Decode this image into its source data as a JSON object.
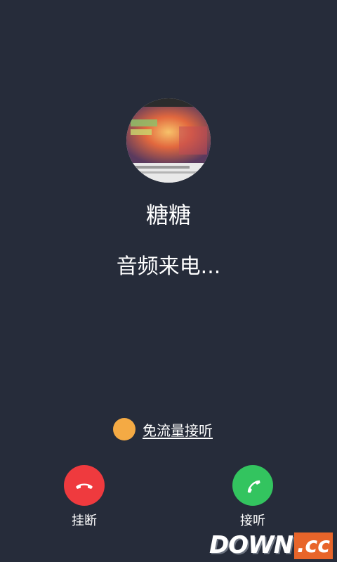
{
  "caller": {
    "name": "糖糖",
    "status": "音频来电..."
  },
  "free_answer": {
    "label": "免流量接听",
    "dot_color": "#f4aa44"
  },
  "actions": {
    "hangup_label": "挂断",
    "answer_label": "接听",
    "hangup_color": "#ef3a3e",
    "answer_color": "#33c45f",
    "hangup_icon": "phone-hangup-icon",
    "answer_icon": "phone-answer-icon"
  },
  "watermark": {
    "main": "DOWN",
    "suffix": ".cc"
  },
  "colors": {
    "background": "#262c3a"
  }
}
